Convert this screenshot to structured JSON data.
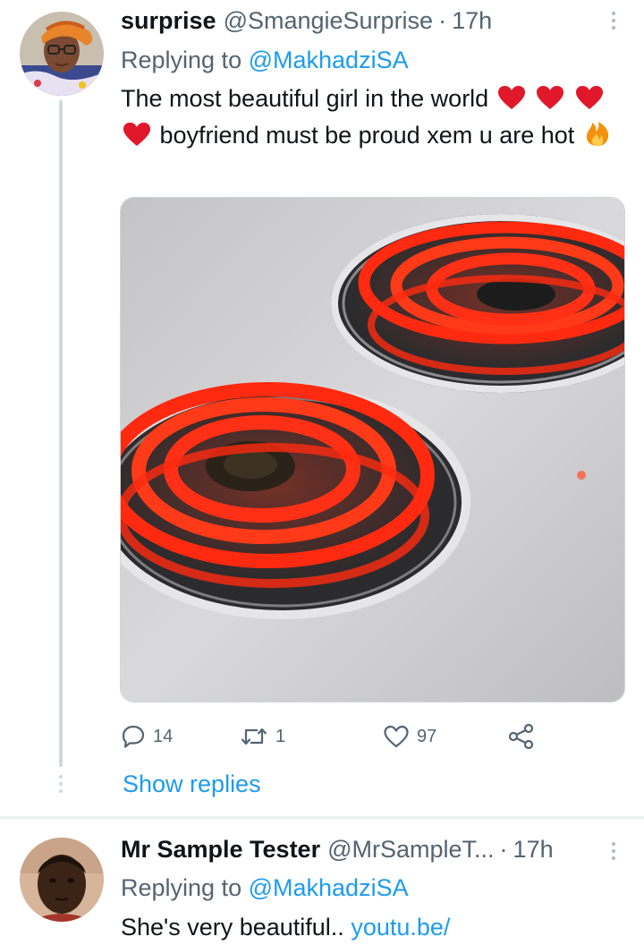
{
  "tweets": [
    {
      "display_name": "surprise",
      "handle": "@SmangieSurprise",
      "separator": "·",
      "time": "17h",
      "replying_prefix": "Replying to",
      "replying_to": "@MakhadziSA",
      "text_part1": "The most beautiful girl in the world",
      "text_part2": "boyfriend must be proud xem u are",
      "text_part3": "hot",
      "emojis": [
        "red-heart",
        "red-heart",
        "red-heart",
        "red-heart",
        "fire"
      ],
      "media_description": "two red-hot electric stove coils",
      "reply_count": "14",
      "retweet_count": "1",
      "like_count": "97",
      "show_replies": "Show replies"
    },
    {
      "display_name": "Mr Sample Tester",
      "handle": "@MrSampleT...",
      "separator": "·",
      "time": "17h",
      "replying_prefix": "Replying to",
      "replying_to": "@MakhadziSA",
      "text": "She's very beautiful..",
      "link": "youtu.be/"
    }
  ],
  "icons": {
    "reply": "comment-icon",
    "retweet": "retweet-icon",
    "like": "heart-outline-icon",
    "share": "share-icon",
    "more": "more-vertical-icon"
  },
  "colors": {
    "accent": "#1d9bf0",
    "secondary_text": "#536471",
    "primary_text": "#0f1419",
    "heart_emoji": "#e0182a",
    "thread_line": "#cfd9de"
  }
}
